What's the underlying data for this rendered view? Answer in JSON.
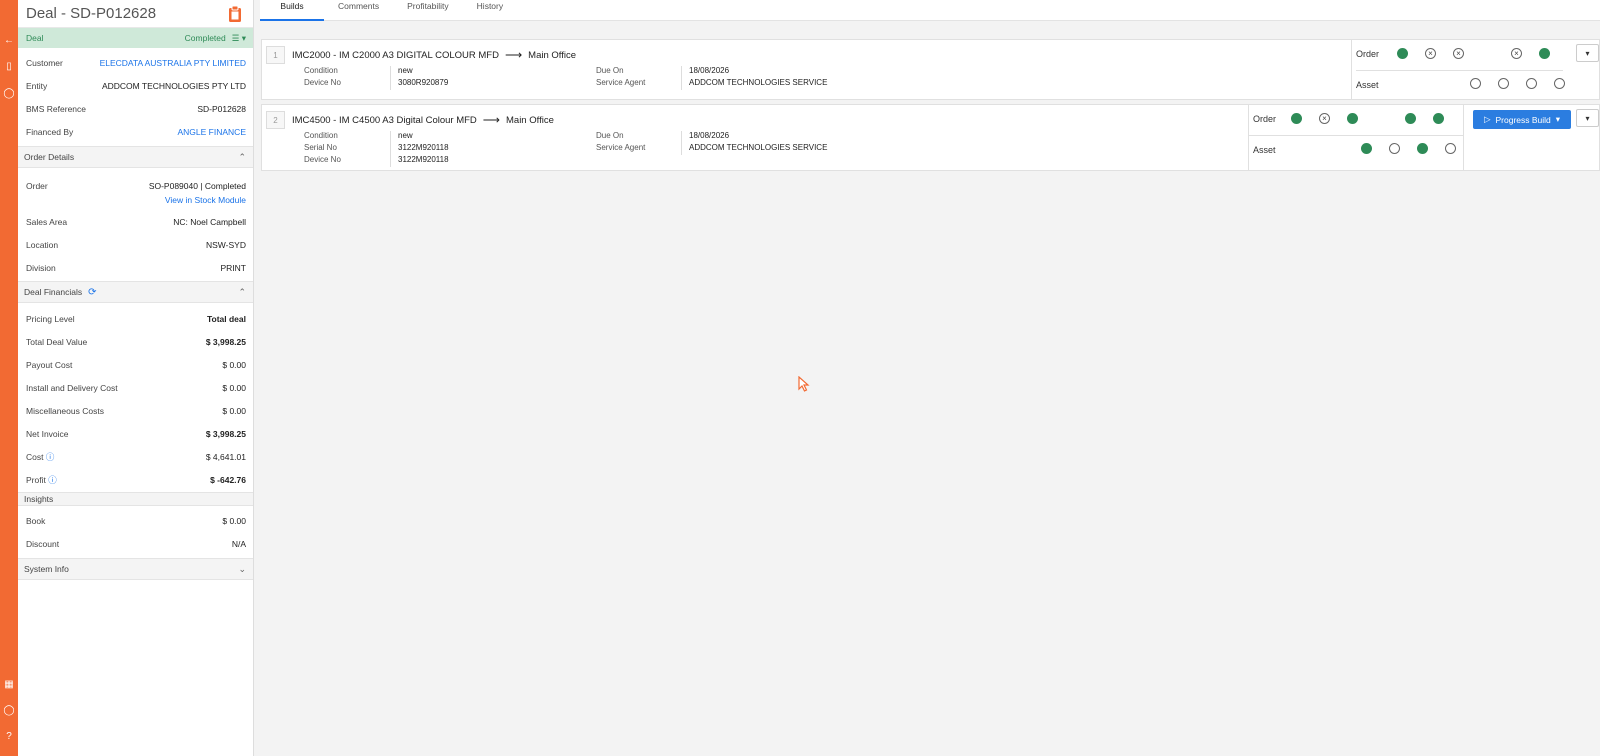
{
  "header": {
    "title": "Deal - SD-P012628"
  },
  "deal_bar": {
    "label": "Deal",
    "status": "Completed"
  },
  "customer": {
    "label": "Customer",
    "value": "ELECDATA AUSTRALIA PTY LIMITED"
  },
  "entity": {
    "label": "Entity",
    "value": "ADDCOM TECHNOLOGIES PTY LTD"
  },
  "bms": {
    "label": "BMS Reference",
    "value": "SD-P012628"
  },
  "financed": {
    "label": "Financed By",
    "value": "ANGLE FINANCE"
  },
  "order_details": {
    "title": "Order Details",
    "order_label": "Order",
    "order_value": "SO-P089040 | Completed",
    "stock_link": "View in Stock Module",
    "sales_area_label": "Sales Area",
    "sales_area_value": "NC: Noel Campbell",
    "location_label": "Location",
    "location_value": "NSW-SYD",
    "division_label": "Division",
    "division_value": "PRINT"
  },
  "financials": {
    "title": "Deal Financials",
    "rows": [
      {
        "label": "Pricing Level",
        "value": "Total deal"
      },
      {
        "label": "Total Deal Value",
        "value": "$ 3,998.25"
      },
      {
        "label": "Payout Cost",
        "value": "$ 0.00"
      },
      {
        "label": "Install and Delivery Cost",
        "value": "$ 0.00"
      },
      {
        "label": "Miscellaneous Costs",
        "value": "$ 0.00"
      },
      {
        "label": "Net Invoice",
        "value": "$ 3,998.25"
      },
      {
        "label": "Cost",
        "value": "$ 4,641.01"
      },
      {
        "label": "Profit",
        "value": "$ -642.76"
      }
    ]
  },
  "insights": {
    "title": "Insights",
    "book_label": "Book",
    "book_value": "$ 0.00",
    "discount_label": "Discount",
    "discount_value": "N/A"
  },
  "system_info": {
    "title": "System Info"
  },
  "tabs": [
    "Builds",
    "Comments",
    "Profitability",
    "History"
  ],
  "builds": [
    {
      "num": "1",
      "title": "IMC2000 - IM C2000 A3 DIGITAL COLOUR MFD",
      "destination": "Main Office",
      "condition_label": "Condition",
      "condition": "new",
      "device_label": "Device No",
      "device": "3080R920879",
      "due_label": "Due On",
      "due": "18/08/2026",
      "agent_label": "Service Agent",
      "agent": "ADDCOM TECHNOLOGIES SERVICE",
      "order_label": "Order",
      "asset_label": "Asset"
    },
    {
      "num": "2",
      "title": "IMC4500 - IM C4500 A3 Digital Colour MFD",
      "destination": "Main Office",
      "condition_label": "Condition",
      "condition": "new",
      "serial_label": "Serial No",
      "serial": "3122M920118",
      "device_label": "Device No",
      "device": "3122M920118",
      "due_label": "Due On",
      "due": "18/08/2026",
      "agent_label": "Service Agent",
      "agent": "ADDCOM TECHNOLOGIES SERVICE",
      "order_label": "Order",
      "asset_label": "Asset",
      "progress_button": "Progress Build"
    }
  ],
  "colors": {
    "accent": "#f26a33",
    "primary": "#2b7de0",
    "success": "#2e8b57"
  }
}
